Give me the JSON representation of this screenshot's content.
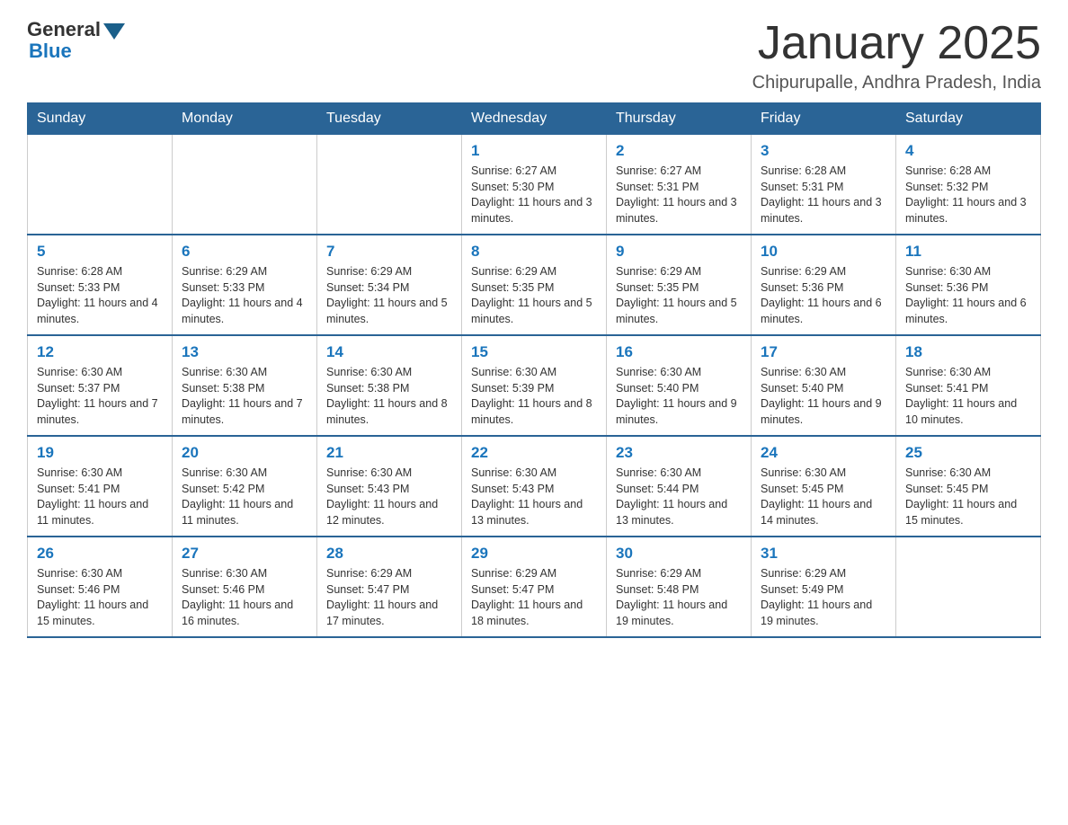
{
  "logo": {
    "general": "General",
    "blue": "Blue"
  },
  "title": "January 2025",
  "location": "Chipurupalle, Andhra Pradesh, India",
  "weekdays": [
    "Sunday",
    "Monday",
    "Tuesday",
    "Wednesday",
    "Thursday",
    "Friday",
    "Saturday"
  ],
  "weeks": [
    [
      {
        "day": "",
        "info": ""
      },
      {
        "day": "",
        "info": ""
      },
      {
        "day": "",
        "info": ""
      },
      {
        "day": "1",
        "info": "Sunrise: 6:27 AM\nSunset: 5:30 PM\nDaylight: 11 hours and 3 minutes."
      },
      {
        "day": "2",
        "info": "Sunrise: 6:27 AM\nSunset: 5:31 PM\nDaylight: 11 hours and 3 minutes."
      },
      {
        "day": "3",
        "info": "Sunrise: 6:28 AM\nSunset: 5:31 PM\nDaylight: 11 hours and 3 minutes."
      },
      {
        "day": "4",
        "info": "Sunrise: 6:28 AM\nSunset: 5:32 PM\nDaylight: 11 hours and 3 minutes."
      }
    ],
    [
      {
        "day": "5",
        "info": "Sunrise: 6:28 AM\nSunset: 5:33 PM\nDaylight: 11 hours and 4 minutes."
      },
      {
        "day": "6",
        "info": "Sunrise: 6:29 AM\nSunset: 5:33 PM\nDaylight: 11 hours and 4 minutes."
      },
      {
        "day": "7",
        "info": "Sunrise: 6:29 AM\nSunset: 5:34 PM\nDaylight: 11 hours and 5 minutes."
      },
      {
        "day": "8",
        "info": "Sunrise: 6:29 AM\nSunset: 5:35 PM\nDaylight: 11 hours and 5 minutes."
      },
      {
        "day": "9",
        "info": "Sunrise: 6:29 AM\nSunset: 5:35 PM\nDaylight: 11 hours and 5 minutes."
      },
      {
        "day": "10",
        "info": "Sunrise: 6:29 AM\nSunset: 5:36 PM\nDaylight: 11 hours and 6 minutes."
      },
      {
        "day": "11",
        "info": "Sunrise: 6:30 AM\nSunset: 5:36 PM\nDaylight: 11 hours and 6 minutes."
      }
    ],
    [
      {
        "day": "12",
        "info": "Sunrise: 6:30 AM\nSunset: 5:37 PM\nDaylight: 11 hours and 7 minutes."
      },
      {
        "day": "13",
        "info": "Sunrise: 6:30 AM\nSunset: 5:38 PM\nDaylight: 11 hours and 7 minutes."
      },
      {
        "day": "14",
        "info": "Sunrise: 6:30 AM\nSunset: 5:38 PM\nDaylight: 11 hours and 8 minutes."
      },
      {
        "day": "15",
        "info": "Sunrise: 6:30 AM\nSunset: 5:39 PM\nDaylight: 11 hours and 8 minutes."
      },
      {
        "day": "16",
        "info": "Sunrise: 6:30 AM\nSunset: 5:40 PM\nDaylight: 11 hours and 9 minutes."
      },
      {
        "day": "17",
        "info": "Sunrise: 6:30 AM\nSunset: 5:40 PM\nDaylight: 11 hours and 9 minutes."
      },
      {
        "day": "18",
        "info": "Sunrise: 6:30 AM\nSunset: 5:41 PM\nDaylight: 11 hours and 10 minutes."
      }
    ],
    [
      {
        "day": "19",
        "info": "Sunrise: 6:30 AM\nSunset: 5:41 PM\nDaylight: 11 hours and 11 minutes."
      },
      {
        "day": "20",
        "info": "Sunrise: 6:30 AM\nSunset: 5:42 PM\nDaylight: 11 hours and 11 minutes."
      },
      {
        "day": "21",
        "info": "Sunrise: 6:30 AM\nSunset: 5:43 PM\nDaylight: 11 hours and 12 minutes."
      },
      {
        "day": "22",
        "info": "Sunrise: 6:30 AM\nSunset: 5:43 PM\nDaylight: 11 hours and 13 minutes."
      },
      {
        "day": "23",
        "info": "Sunrise: 6:30 AM\nSunset: 5:44 PM\nDaylight: 11 hours and 13 minutes."
      },
      {
        "day": "24",
        "info": "Sunrise: 6:30 AM\nSunset: 5:45 PM\nDaylight: 11 hours and 14 minutes."
      },
      {
        "day": "25",
        "info": "Sunrise: 6:30 AM\nSunset: 5:45 PM\nDaylight: 11 hours and 15 minutes."
      }
    ],
    [
      {
        "day": "26",
        "info": "Sunrise: 6:30 AM\nSunset: 5:46 PM\nDaylight: 11 hours and 15 minutes."
      },
      {
        "day": "27",
        "info": "Sunrise: 6:30 AM\nSunset: 5:46 PM\nDaylight: 11 hours and 16 minutes."
      },
      {
        "day": "28",
        "info": "Sunrise: 6:29 AM\nSunset: 5:47 PM\nDaylight: 11 hours and 17 minutes."
      },
      {
        "day": "29",
        "info": "Sunrise: 6:29 AM\nSunset: 5:47 PM\nDaylight: 11 hours and 18 minutes."
      },
      {
        "day": "30",
        "info": "Sunrise: 6:29 AM\nSunset: 5:48 PM\nDaylight: 11 hours and 19 minutes."
      },
      {
        "day": "31",
        "info": "Sunrise: 6:29 AM\nSunset: 5:49 PM\nDaylight: 11 hours and 19 minutes."
      },
      {
        "day": "",
        "info": ""
      }
    ]
  ]
}
